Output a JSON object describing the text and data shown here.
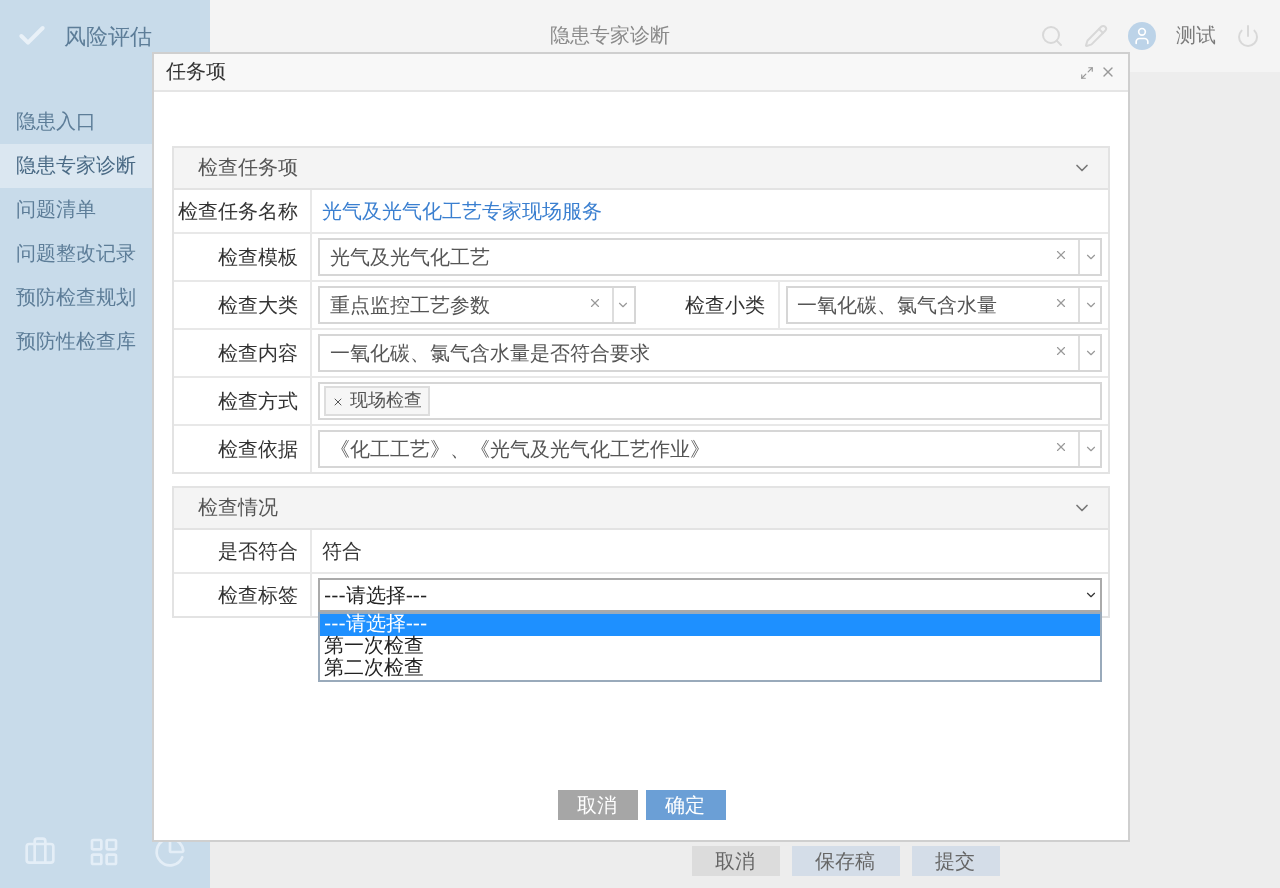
{
  "app": {
    "title": "风险评估",
    "header_title": "隐患专家诊断",
    "user": "测试",
    "sidebar": [
      {
        "label": "隐患入口",
        "selected": false
      },
      {
        "label": "隐患专家诊断",
        "selected": true
      },
      {
        "label": "问题清单",
        "selected": false
      },
      {
        "label": "问题整改记录",
        "selected": false
      },
      {
        "label": "预防检查规划",
        "selected": false
      },
      {
        "label": "预防性检查库",
        "selected": false
      }
    ],
    "footer_buttons": [
      {
        "label": "取消",
        "kind": "secondary"
      },
      {
        "label": "保存稿",
        "kind": "primary"
      },
      {
        "label": "提交",
        "kind": "primary"
      }
    ]
  },
  "dialog": {
    "title": "任务项",
    "sections": [
      {
        "title": "检查任务项",
        "expanded": true,
        "rows": [
          {
            "cells": [
              {
                "label": "检查任务名称",
                "kind": "link",
                "value": "光气及光气化工艺专家现场服务"
              }
            ]
          },
          {
            "cells": [
              {
                "label": "检查模板",
                "kind": "select",
                "value": "光气及光气化工艺"
              }
            ]
          },
          {
            "cells": [
              {
                "label": "检查大类",
                "kind": "select",
                "value": "重点监控工艺参数"
              },
              {
                "label": "检查小类",
                "kind": "select",
                "value": "一氧化碳、氯气含水量"
              }
            ]
          },
          {
            "cells": [
              {
                "label": "检查内容",
                "kind": "select",
                "value": "一氧化碳、氯气含水量是否符合要求"
              }
            ]
          },
          {
            "cells": [
              {
                "label": "检查方式",
                "kind": "tags",
                "tags": [
                  "现场检查"
                ]
              }
            ]
          },
          {
            "cells": [
              {
                "label": "检查依据",
                "kind": "select",
                "value": "《化工工艺》、《光气及光气化工艺作业》"
              }
            ]
          }
        ]
      },
      {
        "title": "检查情况",
        "expanded": true,
        "rows": [
          {
            "cells": [
              {
                "label": "是否符合",
                "kind": "text",
                "value": "符合"
              }
            ]
          },
          {
            "cells": [
              {
                "label": "检查标签",
                "kind": "dropdown",
                "value": "---请选择---",
                "options": [
                  {
                    "label": "---请选择---",
                    "selected": true
                  },
                  {
                    "label": "第一次检查",
                    "selected": false
                  },
                  {
                    "label": "第二次检查",
                    "selected": false
                  }
                ]
              }
            ]
          }
        ]
      }
    ],
    "buttons": [
      {
        "label": "取消",
        "kind": "secondary"
      },
      {
        "label": "确定",
        "kind": "primary"
      }
    ]
  }
}
